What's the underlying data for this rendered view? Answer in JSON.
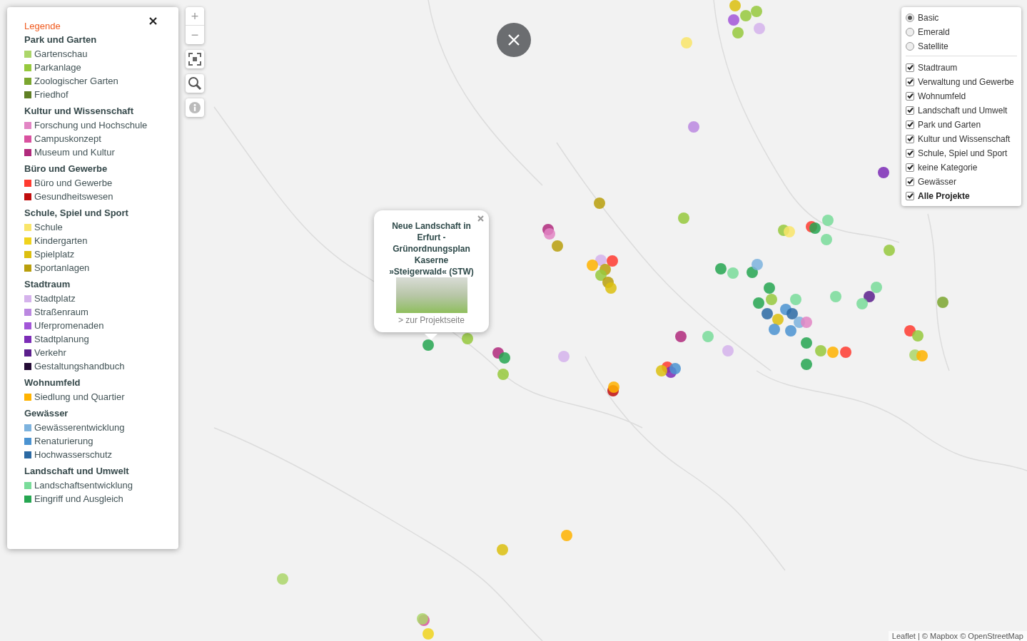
{
  "legend": {
    "title": "Legende",
    "groups": [
      {
        "name": "Park und Garten",
        "items": [
          {
            "label": "Gartenschau",
            "color": "#acd66a"
          },
          {
            "label": "Parkanlage",
            "color": "#96c93d"
          },
          {
            "label": "Zoologischer Garten",
            "color": "#7ba62f"
          },
          {
            "label": "Friedhof",
            "color": "#5f7f24"
          }
        ]
      },
      {
        "name": "Kultur und Wissenschaft",
        "items": [
          {
            "label": "Forschung und Hochschule",
            "color": "#e285c4"
          },
          {
            "label": "Campuskonzept",
            "color": "#d9519f"
          },
          {
            "label": "Museum und Kultur",
            "color": "#b02a7c"
          }
        ]
      },
      {
        "name": "Büro und Gewerbe",
        "items": [
          {
            "label": "Büro und Gewerbe",
            "color": "#ff3b30"
          },
          {
            "label": "Gesundheitswesen",
            "color": "#c00d0d"
          }
        ]
      },
      {
        "name": "Schule, Spiel und Sport",
        "items": [
          {
            "label": "Schule",
            "color": "#f9e56a"
          },
          {
            "label": "Kindergarten",
            "color": "#f0d31d"
          },
          {
            "label": "Spielplatz",
            "color": "#dcbf0f"
          },
          {
            "label": "Sportanlagen",
            "color": "#b99f0c"
          }
        ]
      },
      {
        "name": "Stadtraum",
        "items": [
          {
            "label": "Stadtplatz",
            "color": "#d5b3ec"
          },
          {
            "label": "Straßenraum",
            "color": "#bb88e0"
          },
          {
            "label": "Uferpromenaden",
            "color": "#a256d8"
          },
          {
            "label": "Stadtplanung",
            "color": "#7c2cb6"
          },
          {
            "label": "Verkehr",
            "color": "#5b1f8c"
          },
          {
            "label": "Gestaltungshandbuch",
            "color": "#230b35"
          }
        ]
      },
      {
        "name": "Wohnumfeld",
        "items": [
          {
            "label": "Siedlung und Quartier",
            "color": "#ffb300"
          }
        ]
      },
      {
        "name": "Gewässer",
        "items": [
          {
            "label": "Gewässerentwicklung",
            "color": "#7db3de"
          },
          {
            "label": "Renaturierung",
            "color": "#4b93d1"
          },
          {
            "label": "Hochwasserschutz",
            "color": "#2b6aa3"
          }
        ]
      },
      {
        "name": "Landschaft und Umwelt",
        "items": [
          {
            "label": "Landschaftsentwicklung",
            "color": "#79dc9a"
          },
          {
            "label": "Eingriff und Ausgleich",
            "color": "#26a651"
          }
        ]
      }
    ]
  },
  "map_controls": {
    "zoom_in": "+",
    "zoom_out": "−"
  },
  "popup": {
    "title": "Neue Landschaft in Erfurt - Grünordnungsplan Kaserne »Steigerwald« (STW)",
    "link": "> zur Projektseite"
  },
  "layers": {
    "base": [
      {
        "label": "Basic",
        "selected": true
      },
      {
        "label": "Emerald",
        "selected": false
      },
      {
        "label": "Satellite",
        "selected": false
      }
    ],
    "overlays": [
      {
        "label": "Stadtraum",
        "checked": true,
        "kind": "category"
      },
      {
        "label": "Verwaltung und Gewerbe",
        "checked": true,
        "kind": "category"
      },
      {
        "label": "Wohnumfeld",
        "checked": true,
        "kind": "category"
      },
      {
        "label": "Landschaft und Umwelt",
        "checked": true,
        "kind": "category"
      },
      {
        "label": "Park und Garten",
        "checked": true,
        "kind": "category"
      },
      {
        "label": "Kultur und Wissenschaft",
        "checked": true,
        "kind": "category"
      },
      {
        "label": "Schule, Spiel und Sport",
        "checked": true,
        "kind": "category"
      },
      {
        "label": "keine Kategorie",
        "checked": true,
        "kind": "category"
      },
      {
        "label": "Gewässer",
        "checked": true,
        "kind": "category"
      },
      {
        "label": "Alle Projekte",
        "checked": true,
        "kind": "all"
      }
    ]
  },
  "attribution": "Leaflet | © Mapbox © OpenStreetMap"
}
